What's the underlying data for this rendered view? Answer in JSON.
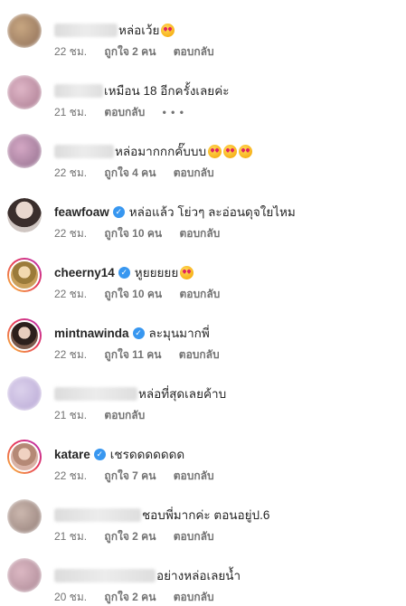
{
  "actions": {
    "reply": "ตอบกลับ",
    "more": "• • •"
  },
  "comments": [
    {
      "text": "หล่อเว้ย",
      "emojis": 1,
      "time": "22 ชม.",
      "likes": "ถูกใจ 2 คน"
    },
    {
      "text": "เหมือน 18 อีกครั้งเลยค่ะ",
      "emojis": 0,
      "time": "21 ชม.",
      "likes": ""
    },
    {
      "text": "หล่อมากกกคั๊บบบ",
      "emojis": 3,
      "time": "22 ชม.",
      "likes": "ถูกใจ 4 คน"
    },
    {
      "username": "feawfoaw",
      "text": "หล่อแล้ว โย่วๆ ละอ่อนดุจใยไหม",
      "emojis": 0,
      "time": "22 ชม.",
      "likes": "ถูกใจ 10 คน"
    },
    {
      "username": "cheerny14",
      "text": "หูยยยยย",
      "emojis": 1,
      "time": "22 ชม.",
      "likes": "ถูกใจ 10 คน"
    },
    {
      "username": "mintnawinda",
      "text": "ละมุนมากพี่",
      "emojis": 0,
      "time": "22 ชม.",
      "likes": "ถูกใจ 11 คน"
    },
    {
      "text": "หล่อที่สุดเลยค้าบ",
      "emojis": 0,
      "time": "21 ชม.",
      "likes": ""
    },
    {
      "username": "katare",
      "text": "เชรดดดดดดด",
      "emojis": 0,
      "time": "22 ชม.",
      "likes": "ถูกใจ 7 คน"
    },
    {
      "text": "ชอบพี่มากค่ะ ตอนอยู่ป.6",
      "emojis": 0,
      "time": "21 ชม.",
      "likes": "ถูกใจ 2 คน"
    },
    {
      "text": "อย่างหล่อเลยน้ำ",
      "emojis": 0,
      "time": "20 ชม.",
      "likes": "ถูกใจ 2 คน"
    }
  ]
}
